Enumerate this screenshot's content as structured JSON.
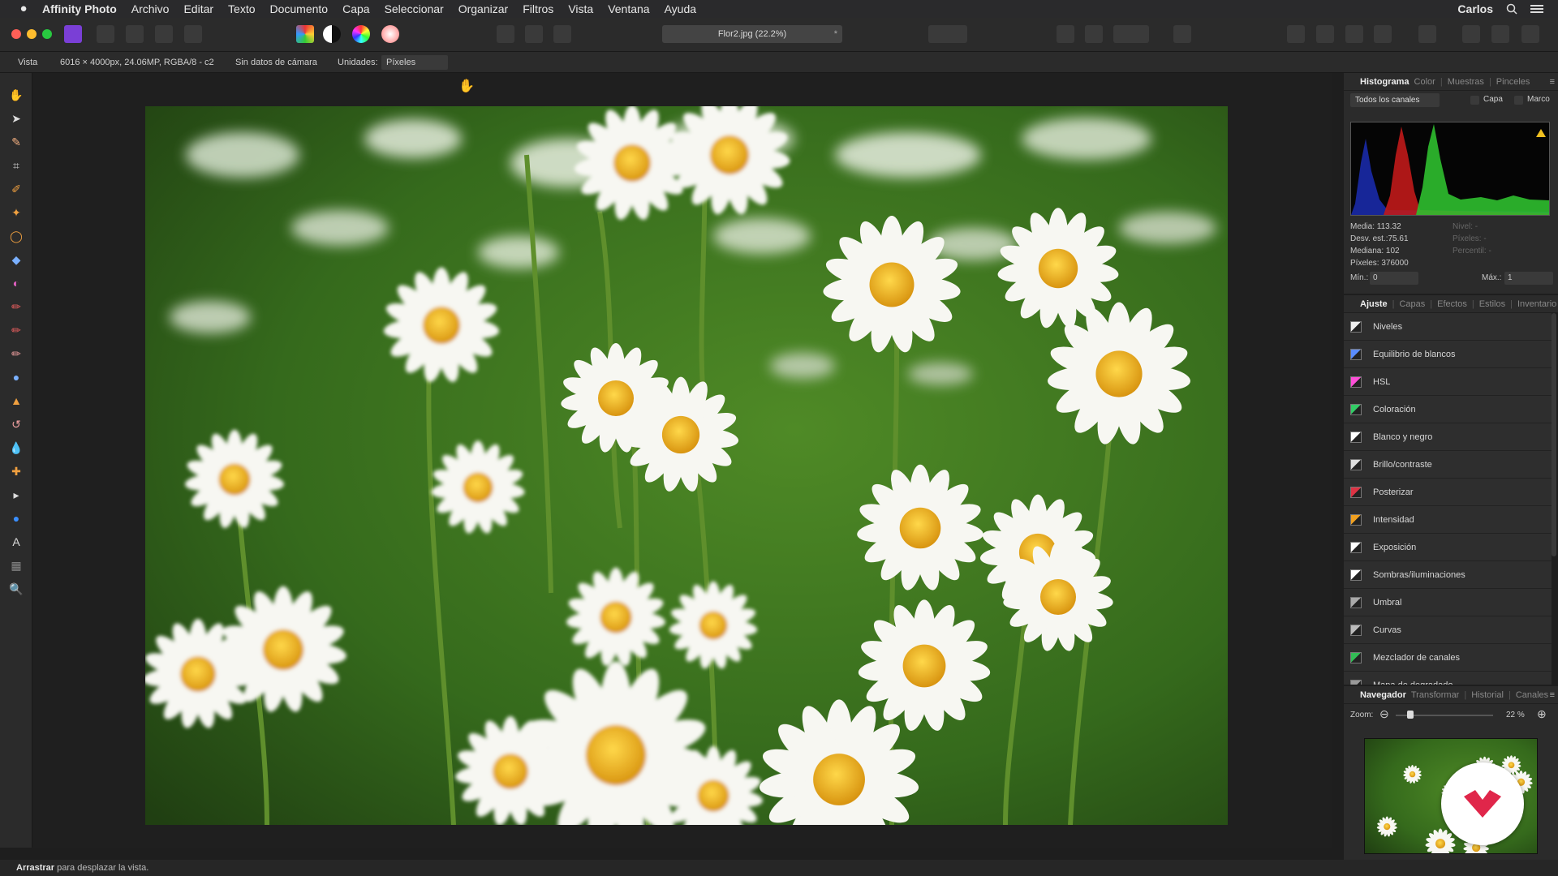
{
  "menubar": {
    "apple_icon": "apple-icon",
    "app_name": "Affinity Photo",
    "items": [
      "Archivo",
      "Editar",
      "Texto",
      "Documento",
      "Capa",
      "Seleccionar",
      "Organizar",
      "Filtros",
      "Vista",
      "Ventana",
      "Ayuda"
    ],
    "user": "Carlos"
  },
  "toolbar": {
    "document_tab": "Flor2.jpg (22.2%)",
    "close_glyph": "*"
  },
  "context_bar": {
    "persona": "Vista",
    "image_info": "6016 × 4000px, 24.06MP, RGBA/8 - c2",
    "camera": "Sin datos de cámara",
    "units_label": "Unidades:",
    "units_value": "Píxeles"
  },
  "histogram_panel": {
    "tabs": [
      "Histograma",
      "Color",
      "Muestras",
      "Pinceles"
    ],
    "active_tab": "Histograma",
    "channel_select": "Todos los canales",
    "check_layer": "Capa",
    "check_frame": "Marco",
    "stats": {
      "media": "Media: 113.32",
      "desv": "Desv. est.:75.61",
      "mediana": "Mediana: 102",
      "pixeles": "Píxeles: 376000"
    },
    "stats_right": {
      "nivel": "Nivel: -",
      "pixeles": "Píxeles: -",
      "percentil": "Percentil: -"
    },
    "min_label": "Mín.:",
    "min_value": "0",
    "max_label": "Máx.:",
    "max_value": "1"
  },
  "adjust_panel": {
    "tabs": [
      "Ajuste",
      "Capas",
      "Efectos",
      "Estilos",
      "Inventario"
    ],
    "active_tab": "Ajuste",
    "items": [
      {
        "label": "Niveles",
        "icon": "levels-icon",
        "color": "#eeeeee"
      },
      {
        "label": "Equilibrio de blancos",
        "icon": "white-balance-icon",
        "color": "#5a8cff"
      },
      {
        "label": "HSL",
        "icon": "hsl-icon",
        "color": "#ff4fd8"
      },
      {
        "label": "Coloración",
        "icon": "recolor-icon",
        "color": "#33cc66"
      },
      {
        "label": "Blanco y negro",
        "icon": "black-white-icon",
        "color": "#ffffff"
      },
      {
        "label": "Brillo/contraste",
        "icon": "brightness-contrast-icon",
        "color": "#dddddd"
      },
      {
        "label": "Posterizar",
        "icon": "posterize-icon",
        "color": "#dd3344"
      },
      {
        "label": "Intensidad",
        "icon": "vibrance-icon",
        "color": "#f0a020"
      },
      {
        "label": "Exposición",
        "icon": "exposure-icon",
        "color": "#ffffff"
      },
      {
        "label": "Sombras/iluminaciones",
        "icon": "shadows-highlights-icon",
        "color": "#ffffff"
      },
      {
        "label": "Umbral",
        "icon": "threshold-icon",
        "color": "#aaaaaa"
      },
      {
        "label": "Curvas",
        "icon": "curves-icon",
        "color": "#bbbbbb"
      },
      {
        "label": "Mezclador de canales",
        "icon": "channel-mixer-icon",
        "color": "#33bb55"
      },
      {
        "label": "Mapa de degradado",
        "icon": "gradient-map-icon",
        "color": "#999999"
      }
    ]
  },
  "navigator_panel": {
    "tabs": [
      "Navegador",
      "Transformar",
      "Historial",
      "Canales"
    ],
    "active_tab": "Navegador",
    "zoom_label": "Zoom:",
    "zoom_value": "22 %"
  },
  "status": {
    "action": "Arrastrar",
    "hint": "para desplazar la vista."
  },
  "colors": {
    "accent": "#e0264a",
    "window_bg": "#2b2b2b",
    "canvas_bg": "#1f1f1f"
  }
}
